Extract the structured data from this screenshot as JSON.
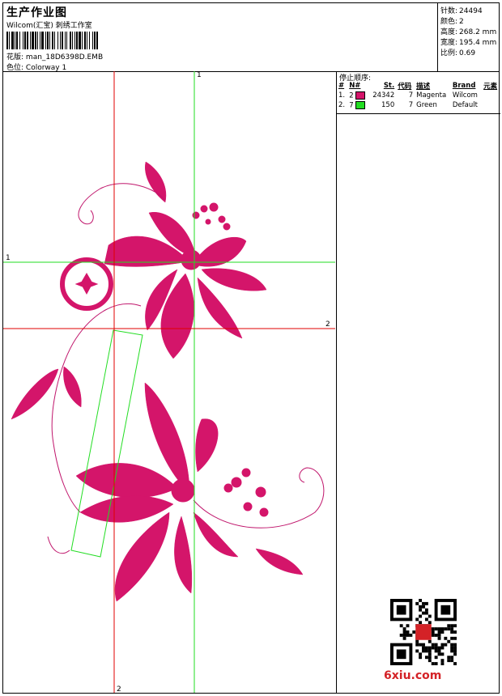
{
  "header": {
    "title": "生产作业图",
    "studio": "Wilcom(汇宝) 刺绣工作室",
    "design_file_label": "花版:",
    "design_file": "man_18D6398D.EMB",
    "colorway_label": "色位:",
    "colorway": "Colorway 1"
  },
  "stats": [
    {
      "label": "针数:",
      "value": "24494"
    },
    {
      "label": "颜色:",
      "value": "2"
    },
    {
      "label": "高度:",
      "value": "268.2 mm"
    },
    {
      "label": "宽度:",
      "value": "195.4 mm"
    },
    {
      "label": "比例:",
      "value": "0.69"
    }
  ],
  "stop_panel": {
    "title": "停止顺序:",
    "columns": [
      "#",
      "N#",
      "St.",
      "代码",
      "描述",
      "Brand",
      "元素"
    ],
    "rows": [
      {
        "index": "1.",
        "n": "2",
        "swatch": "#d4156a",
        "st": "24342",
        "code": "7",
        "desc": "Magenta",
        "brand": "Wilcom"
      },
      {
        "index": "2.",
        "n": "7",
        "swatch": "#22dd22",
        "st": "150",
        "code": "7",
        "desc": "Green",
        "brand": "Default"
      }
    ]
  },
  "guides": {
    "green_v": "1",
    "green_h": "1",
    "red_h": "2",
    "red_v": "2"
  },
  "colors": {
    "magenta": "#d4156a",
    "green": "#22dd22",
    "red": "#e00000"
  },
  "watermark": {
    "site": "6xiu.com",
    "icon": "qr-code-icon"
  }
}
